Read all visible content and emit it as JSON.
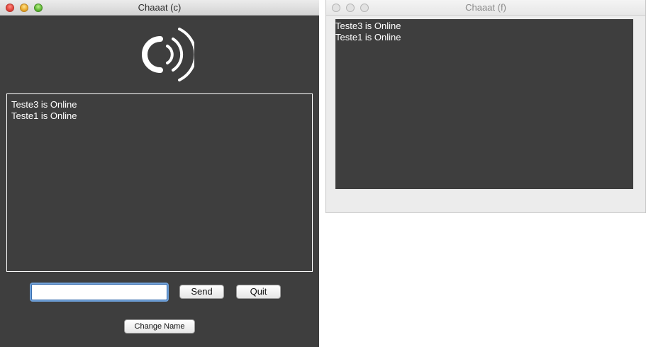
{
  "window_c": {
    "title": "Chaaat (c)",
    "logo_icon": "broadcast-c-logo-icon",
    "messages": [
      "Teste3 is Online",
      "Teste1 is Online"
    ],
    "message_input": {
      "value": "",
      "placeholder": ""
    },
    "send_label": "Send",
    "quit_label": "Quit",
    "change_name_label": "Change Name"
  },
  "window_f": {
    "title": "Chaaat (f)",
    "messages": [
      "Teste3 is Online",
      "Teste1 is Online"
    ]
  },
  "colors": {
    "window_background": "#3e3e3e",
    "text": "#ffffff",
    "focus_ring": "#6fa0d8"
  }
}
